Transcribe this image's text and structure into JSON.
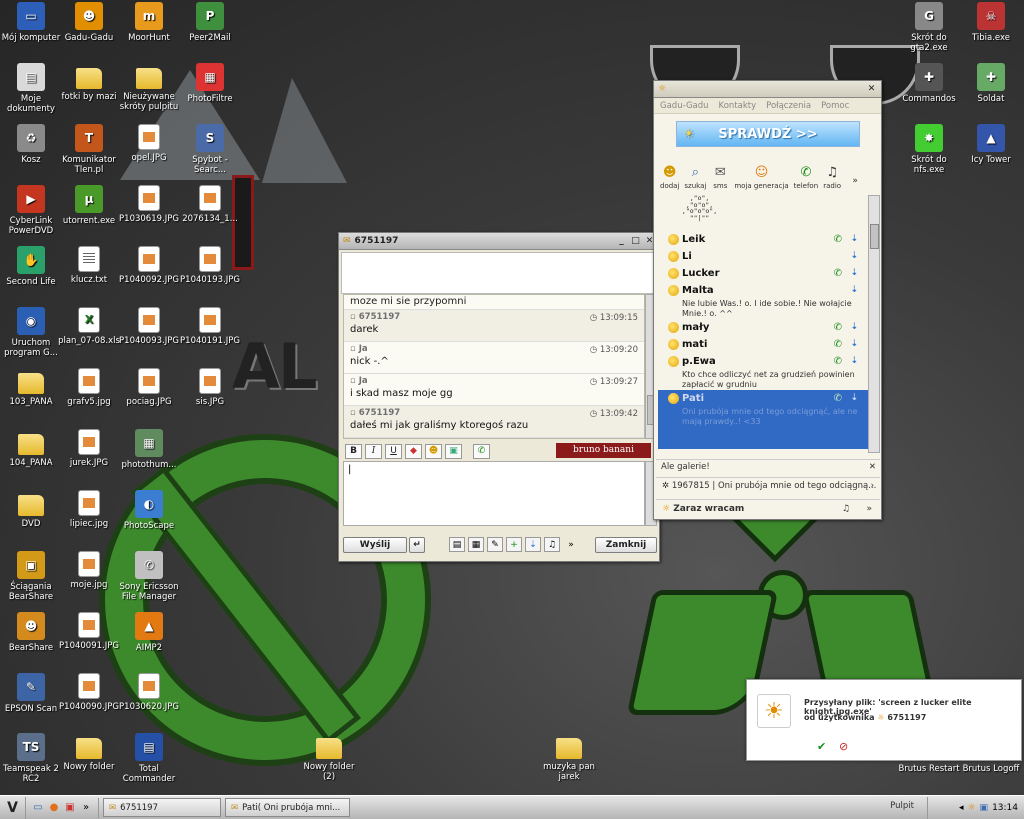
{
  "desktop_icons": [
    {
      "label": "Mój komputer",
      "icon": "computer-icon"
    },
    {
      "label": "Gadu-Gadu",
      "icon": "gadu-gadu-icon"
    },
    {
      "label": "MoorHunt",
      "icon": "moorhunt-icon"
    },
    {
      "label": "Peer2Mail",
      "icon": "peer2mail-icon"
    },
    {
      "label": "Moje dokumenty",
      "icon": "documents-icon"
    },
    {
      "label": "fotki by mazi",
      "icon": "folder-icon"
    },
    {
      "label": "Nieużywane skróty pulpitu",
      "icon": "folder-icon"
    },
    {
      "label": "PhotoFiltre",
      "icon": "photofiltre-icon"
    },
    {
      "label": "Kosz",
      "icon": "recycle-bin-icon"
    },
    {
      "label": "Komunikator Tlen.pl",
      "icon": "tlen-icon"
    },
    {
      "label": "opel.JPG",
      "icon": "image-file-icon"
    },
    {
      "label": "Spybot - Searc...",
      "icon": "spybot-icon"
    },
    {
      "label": "CyberLink PowerDVD",
      "icon": "powerdvd-icon"
    },
    {
      "label": "utorrent.exe",
      "icon": "utorrent-icon"
    },
    {
      "label": "P1030619.JPG",
      "icon": "image-file-icon"
    },
    {
      "label": "2076134_1...",
      "icon": "image-file-icon"
    },
    {
      "label": "Second Life",
      "icon": "second-life-icon"
    },
    {
      "label": "klucz.txt",
      "icon": "text-file-icon"
    },
    {
      "label": "P1040092.JPG",
      "icon": "image-file-icon"
    },
    {
      "label": "P1040193.JPG",
      "icon": "image-file-icon"
    },
    {
      "label": "Uruchom program G...",
      "icon": "google-earth-icon"
    },
    {
      "label": "plan_07-08.xls",
      "icon": "excel-file-icon"
    },
    {
      "label": "P1040093.JPG",
      "icon": "image-file-icon"
    },
    {
      "label": "P1040191.JPG",
      "icon": "image-file-icon"
    },
    {
      "label": "103_PANA",
      "icon": "folder-icon"
    },
    {
      "label": "grafv5.jpg",
      "icon": "image-file-icon"
    },
    {
      "label": "pociag.JPG",
      "icon": "image-file-icon"
    },
    {
      "label": "sis.JPG",
      "icon": "image-file-icon"
    },
    {
      "label": "104_PANA",
      "icon": "folder-icon"
    },
    {
      "label": "jurek.JPG",
      "icon": "image-file-icon"
    },
    {
      "label": "photothum...",
      "icon": "photothumb-icon"
    },
    {
      "label": "DVD",
      "icon": "folder-icon"
    },
    {
      "label": "lipiec.jpg",
      "icon": "image-file-icon"
    },
    {
      "label": "PhotoScape",
      "icon": "photoscape-icon"
    },
    {
      "label": "Ściągania BearShare",
      "icon": "bearshare-folder-icon"
    },
    {
      "label": "moje.jpg",
      "icon": "image-file-icon"
    },
    {
      "label": "Sony Ericsson File Manager",
      "icon": "sony-ericsson-icon"
    },
    {
      "label": "BearShare",
      "icon": "bearshare-icon"
    },
    {
      "label": "P1040091.JPG",
      "icon": "image-file-icon"
    },
    {
      "label": "AIMP2",
      "icon": "aimp-icon"
    },
    {
      "label": "EPSON Scan",
      "icon": "epson-scan-icon"
    },
    {
      "label": "P1040090.JPG",
      "icon": "image-file-icon"
    },
    {
      "label": "P1030620.JPG",
      "icon": "image-file-icon"
    },
    {
      "label": "Teamspeak 2 RC2",
      "icon": "teamspeak-icon"
    },
    {
      "label": "Nowy folder",
      "icon": "folder-icon"
    },
    {
      "label": "Total Commander",
      "icon": "total-commander-icon"
    },
    {
      "label": "Nowy folder (2)",
      "icon": "folder-icon"
    },
    {
      "label": "muzyka pan jarek",
      "icon": "folder-icon"
    },
    {
      "label": "Skrót do gta2.exe",
      "icon": "gta2-icon"
    },
    {
      "label": "Tibia.exe",
      "icon": "tibia-icon"
    },
    {
      "label": "Commandos",
      "icon": "commandos-icon"
    },
    {
      "label": "Soldat",
      "icon": "soldat-icon"
    },
    {
      "label": "Skrót do nfs.exe",
      "icon": "nfs-icon"
    },
    {
      "label": "Icy Tower",
      "icon": "icy-tower-icon"
    },
    {
      "label": "Brutus Restart",
      "icon": "brutus-restart-icon"
    },
    {
      "label": "Brutus Logoff",
      "icon": "brutus-logoff-icon"
    }
  ],
  "chat": {
    "title": "6751197",
    "first_line": "moze mi sie przypomni",
    "messages": [
      {
        "who": "6751197",
        "time": "13:09:15",
        "text": "darek"
      },
      {
        "who": "Ja",
        "time": "13:09:20",
        "text": "nick -.^"
      },
      {
        "who": "Ja",
        "time": "13:09:27",
        "text": "i skad masz moje gg"
      },
      {
        "who": "6751197",
        "time": "13:09:42",
        "text": "dałeś mi jak graliśmy ktoregoś razu"
      }
    ],
    "format_bold": "B",
    "format_italic": "I",
    "format_underline": "U",
    "brand": "bruno banani",
    "send_label": "Wyślij",
    "close_label": "Zamknij"
  },
  "gg": {
    "menu": [
      "Gadu-Gadu",
      "Kontakty",
      "Połączenia",
      "Pomoc"
    ],
    "banner": "SPRAWDŹ >>",
    "toolbar": [
      "dodaj",
      "szukaj",
      "sms",
      "moja generacja",
      "telefon",
      "radio"
    ],
    "ascii": "   ,\"o\",\n  ,\"o\"o\",\n ,\"o\"o\"o\",\n   \"\"|\"\"",
    "contacts": [
      {
        "name": "Leik",
        "desc": ""
      },
      {
        "name": "Li",
        "desc": ""
      },
      {
        "name": "Lucker",
        "desc": ""
      },
      {
        "name": "Malta",
        "desc": "Nie lubie Was.! o.   I ide sobie.!   Nie wołajcie Mnie.! o.        ^^"
      },
      {
        "name": "mały",
        "desc": ""
      },
      {
        "name": "mati",
        "desc": ""
      },
      {
        "name": "p.Ewa",
        "desc": "Kto chce odliczyć net za grudzień powinien zapłacić w grudniu"
      }
    ],
    "selected_contact": {
      "name": "Pati",
      "desc": "Oni prubója mnie od tego odciągnąć, ale ne mają prawdy..! <33"
    },
    "status_note": "Ale galerie!",
    "status_recent": "1967815 |  Oni prubója mnie od tego odciągną...",
    "status_self": "Zaraz wracam"
  },
  "notification": {
    "line1": "Przysyłany plik: 'screen z lucker elite knight.jpg.exe'",
    "from_label": "od użytkownika",
    "from_user": "6751197"
  },
  "taskbar": {
    "tasks": [
      "6751197",
      "Pati( Oni prubója mni..."
    ],
    "pulpit": "Pulpit",
    "clock": "13:14"
  },
  "wallpaper_text": "AL"
}
